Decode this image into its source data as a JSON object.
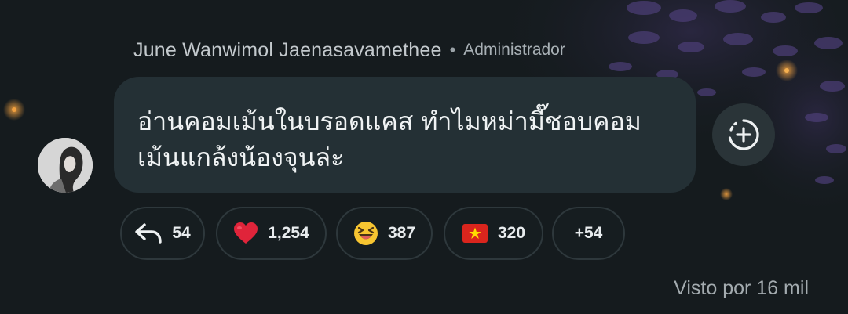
{
  "message": {
    "author": "June Wanwimol Jaenasavamethee",
    "separator": "•",
    "role": "Administrador",
    "text_line1": "อ่านคอมเม้นในบรอดแคส ทำไมหม่ามี๊ชอบคอม",
    "text_line2": "เม้นแกล้งน้องจุนล่ะ",
    "avatar_icon": "avatar-photo",
    "add_reaction_icon": "add-reaction-icon"
  },
  "reactions": [
    {
      "icon": "reply-arrow-icon",
      "count": "54"
    },
    {
      "icon": "red-heart-emoji",
      "count": "1,254"
    },
    {
      "icon": "grinning-squinting-emoji",
      "count": "387"
    },
    {
      "icon": "vietnam-flag-emoji",
      "count": "320"
    },
    {
      "icon": "",
      "count": "+54"
    }
  ],
  "footer": {
    "seen_text": "Visto por 16 mil"
  },
  "colors": {
    "background": "#151b1e",
    "bubble": "#243035",
    "chip_border": "#2e383c",
    "heart": "#e0243a",
    "flag_red": "#da251d",
    "flag_star": "#ffdd00"
  }
}
